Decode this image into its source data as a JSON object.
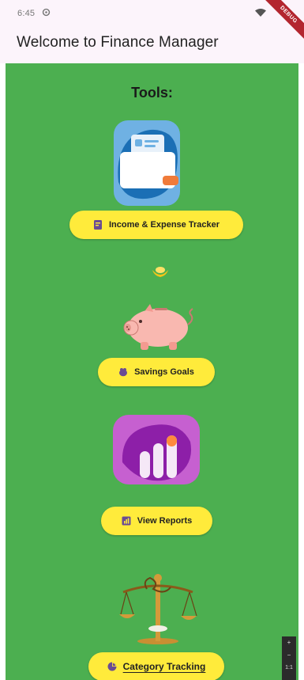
{
  "status_bar": {
    "time": "6:45",
    "settings_icon": "gear-icon",
    "wifi_icon": "wifi-icon",
    "banner": "DEBUG"
  },
  "app_bar": {
    "title": "Welcome to Finance Manager"
  },
  "main": {
    "background_color": "#4caf50",
    "tools_heading": "Tools:",
    "tools": [
      {
        "label": "Income & Expense Tracker",
        "icon": "wallet-icon",
        "button_icon": "receipt-icon"
      },
      {
        "label": "Savings Goals",
        "icon": "piggy-bank-icon",
        "button_icon": "savings-icon"
      },
      {
        "label": "View Reports",
        "icon": "bar-chart-icon",
        "button_icon": "report-icon"
      },
      {
        "label": "Category Tracking",
        "icon": "scales-icon",
        "button_icon": "pie-chart-icon"
      }
    ],
    "button_color": "#ffeb3b"
  },
  "zoom_widget": {
    "plus": "+",
    "minus": "−",
    "level": "1:1"
  }
}
